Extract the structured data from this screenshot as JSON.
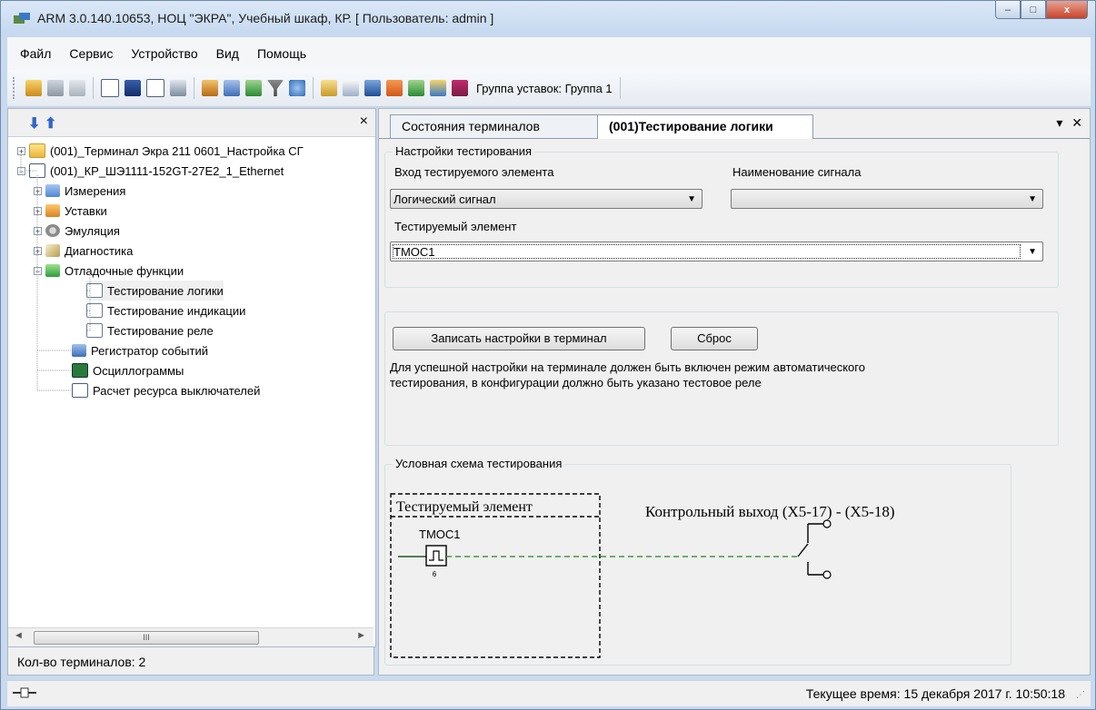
{
  "window": {
    "title": "ARM 3.0.140.10653, НОЦ \"ЭКРА\", Учебный шкаф, КР. [ Пользователь: admin ]",
    "controls": {
      "minimize": "–",
      "maximize": "□",
      "close": "x"
    }
  },
  "menu": [
    "Файл",
    "Сервис",
    "Устройство",
    "Вид",
    "Помощь"
  ],
  "toolbar": {
    "group_label": "Группа уставок: Группа 1"
  },
  "left_panel": {
    "close": "×",
    "tree": [
      {
        "label": "(001)_Терминал Экра 211 0601_Настройка СГ",
        "pm": "+",
        "icon": "folder-icon"
      },
      {
        "label": "(001)_КР_ШЭ1111-152GT-27E2_1_Ethernet",
        "pm": "−",
        "icon": "terminal-icon"
      },
      {
        "label": "Измерения",
        "pm": "+",
        "icon": "measurements-icon"
      },
      {
        "label": "Уставки",
        "pm": "+",
        "icon": "settings-box-icon"
      },
      {
        "label": "Эмуляция",
        "pm": "+",
        "icon": "emulation-icon"
      },
      {
        "label": "Диагностика",
        "pm": "+",
        "icon": "diagnostics-icon"
      },
      {
        "label": "Отладочные функции",
        "pm": "−",
        "icon": "debug-icon"
      },
      {
        "label": "Тестирование логики",
        "pm": "",
        "icon": "document-icon"
      },
      {
        "label": "Тестирование индикации",
        "pm": "",
        "icon": "document-icon"
      },
      {
        "label": "Тестирование реле",
        "pm": "",
        "icon": "document-icon"
      },
      {
        "label": "Регистратор событий",
        "pm": "",
        "icon": "book-icon"
      },
      {
        "label": "Осциллограммы",
        "pm": "",
        "icon": "oscillogram-icon"
      },
      {
        "label": "Расчет ресурса выключателей",
        "pm": "",
        "icon": "calc-icon"
      }
    ],
    "scroll": {
      "thumb": "III",
      "left": "◄",
      "right": "►"
    },
    "status": "Кол-во терминалов: 2"
  },
  "tabs": {
    "t1": "Состояния терминалов",
    "t2": "(001)Тестирование логики",
    "menu": "▾",
    "close": "✕"
  },
  "settings": {
    "legend": "Настройки тестирования",
    "input_label": "Вход тестируемого элемента",
    "input_value": "Логический сигнал",
    "signal_label": "Наименование сигнала",
    "signal_value": "",
    "element_label": "Тестируемый элемент",
    "element_value": "ТМОС1",
    "dropdown": "▼"
  },
  "actions": {
    "write_button": "Записать настройки в терминал",
    "reset_button": "Сброс",
    "note_line1": "Для успешной настройки на терминале должен быть включен режим автоматического",
    "note_line2": "тестирования, в конфигурации должно быть указано тестовое реле"
  },
  "schema": {
    "legend": "Условная схема тестирования",
    "element_box_title": "Тестируемый элемент",
    "element_name": "ТМОС1",
    "element_sub": "6",
    "output_label": "Контрольный выход (X5-17) - (X5-18)"
  },
  "statusbar": {
    "time": "Текущее время: 15 декабря 2017 г. 10:50:18"
  }
}
